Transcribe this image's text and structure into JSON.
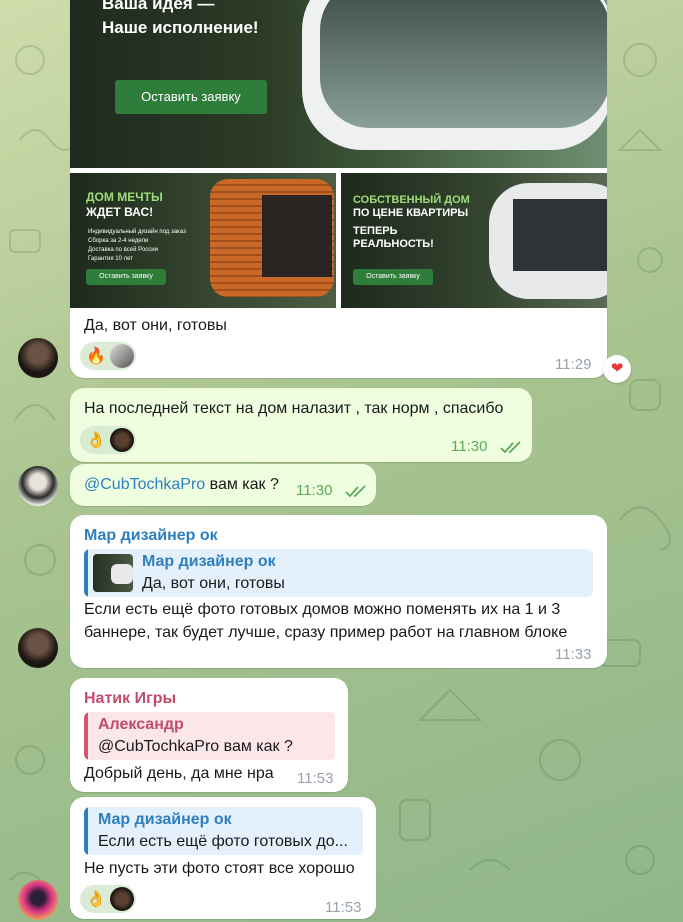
{
  "messages": {
    "m1": {
      "banner_top": {
        "title": "Ваша идея —\nНаше исполнение!",
        "line1": "Ваша идея —",
        "line2": "Наше исполнение!",
        "button": "Оставить заявку"
      },
      "banner_left": {
        "line1": "ДОМ МЕЧТЫ",
        "line2": "ЖДЕТ ВАС!",
        "bullets": [
          "Индивидуальный дизайн под заказ",
          "Сборка за 2-4 недели",
          "Доставка по всей России",
          "Гарантия 10 лет"
        ],
        "button": "Оставить заявку"
      },
      "banner_right": {
        "line1": "СОБСТВЕННЫЙ ДОМ",
        "line2": "ПО ЦЕНЕ КВАРТИРЫ",
        "line3": "ТЕПЕРЬ",
        "line4": "РЕАЛЬНОСТЬ!",
        "button": "Оставить заявку"
      },
      "text": "Да, вот они, готовы",
      "time": "11:29",
      "reaction": "🔥"
    },
    "m2": {
      "text": "На последней текст на дом налазит , так норм , спасибо",
      "time": "11:30",
      "reaction": "👌"
    },
    "m3": {
      "mention": "@CubTochkaPro",
      "text": " вам как ?",
      "time": "11:30"
    },
    "m4": {
      "sender": "Мар дизайнер ок",
      "quote_sender": "Мар дизайнер ок",
      "quote_text": "Да, вот они, готовы",
      "line1": "Если есть ещё фото готовых домов можно поменять их на 1 и 3",
      "line2": "баннере, так будет лучше, сразу пример работ на главном блоке",
      "time": "11:33"
    },
    "m5": {
      "sender": "Натик Игры",
      "quote_sender": "Александр",
      "quote_text": "@CubTochkaPro вам как ?",
      "text": "Добрый день, да мне нра",
      "time": "11:53"
    },
    "m6": {
      "quote_sender": "Мар дизайнер ок",
      "quote_text": "Если есть ещё фото готовых до...",
      "text": "Не пусть эти фото стоят все хорошо",
      "time": "11:53",
      "reaction": "👌"
    }
  },
  "colors": {
    "accent_blue": "#2f7fbf",
    "sender_pink": "#c44a6e",
    "quote_pink_bg": "#fbe6e9",
    "quote_blue_bg": "#e4f0fb",
    "outgoing_bg": "#eefedf",
    "check_green": "#5da85a"
  }
}
